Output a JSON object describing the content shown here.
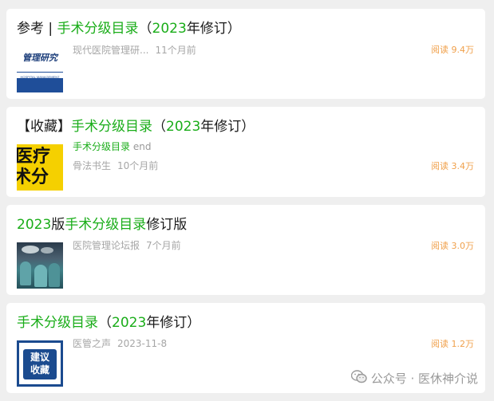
{
  "articles": [
    {
      "title_pre": "参考 | ",
      "title_kw": "手术分级目录",
      "title_mid": "（",
      "title_year": "2023",
      "title_post": "年修订）",
      "source": "现代医院管理研...",
      "time": "11个月前",
      "reads": "阅读 9.4万",
      "thumb_text": "管理研究",
      "thumb_sub": "HOSPITAL MANAGEMENT"
    },
    {
      "title_pre": "【收藏】",
      "title_kw": "手术分级目录",
      "title_mid": "（",
      "title_year": "2023",
      "title_post": "年修订）",
      "snippet_kw": "手术分级目录",
      "snippet_rest": " end",
      "source": "骨法书生",
      "time": "10个月前",
      "reads": "阅读 3.4万",
      "thumb_line1": "医疗",
      "thumb_line2": "术分"
    },
    {
      "title_year": "2023",
      "title_pre": "版",
      "title_kw": "手术分级目录",
      "title_post": "修订版",
      "source": "医院管理论坛报",
      "time": "7个月前",
      "reads": "阅读 3.0万"
    },
    {
      "title_kw": "手术分级目录",
      "title_mid": "（",
      "title_year": "2023",
      "title_post": "年修订）",
      "source": "医管之声",
      "time": "2023-11-8",
      "reads": "阅读 1.2万",
      "thumb_line1": "建议",
      "thumb_line2": "收藏"
    }
  ],
  "watermark": {
    "icon": "wechat-icon",
    "text": "公众号 · 医休神介说"
  },
  "colors": {
    "highlight": "#1aad19",
    "reads": "#f0a04b",
    "meta": "#a6a6a6",
    "background": "#efefef"
  }
}
